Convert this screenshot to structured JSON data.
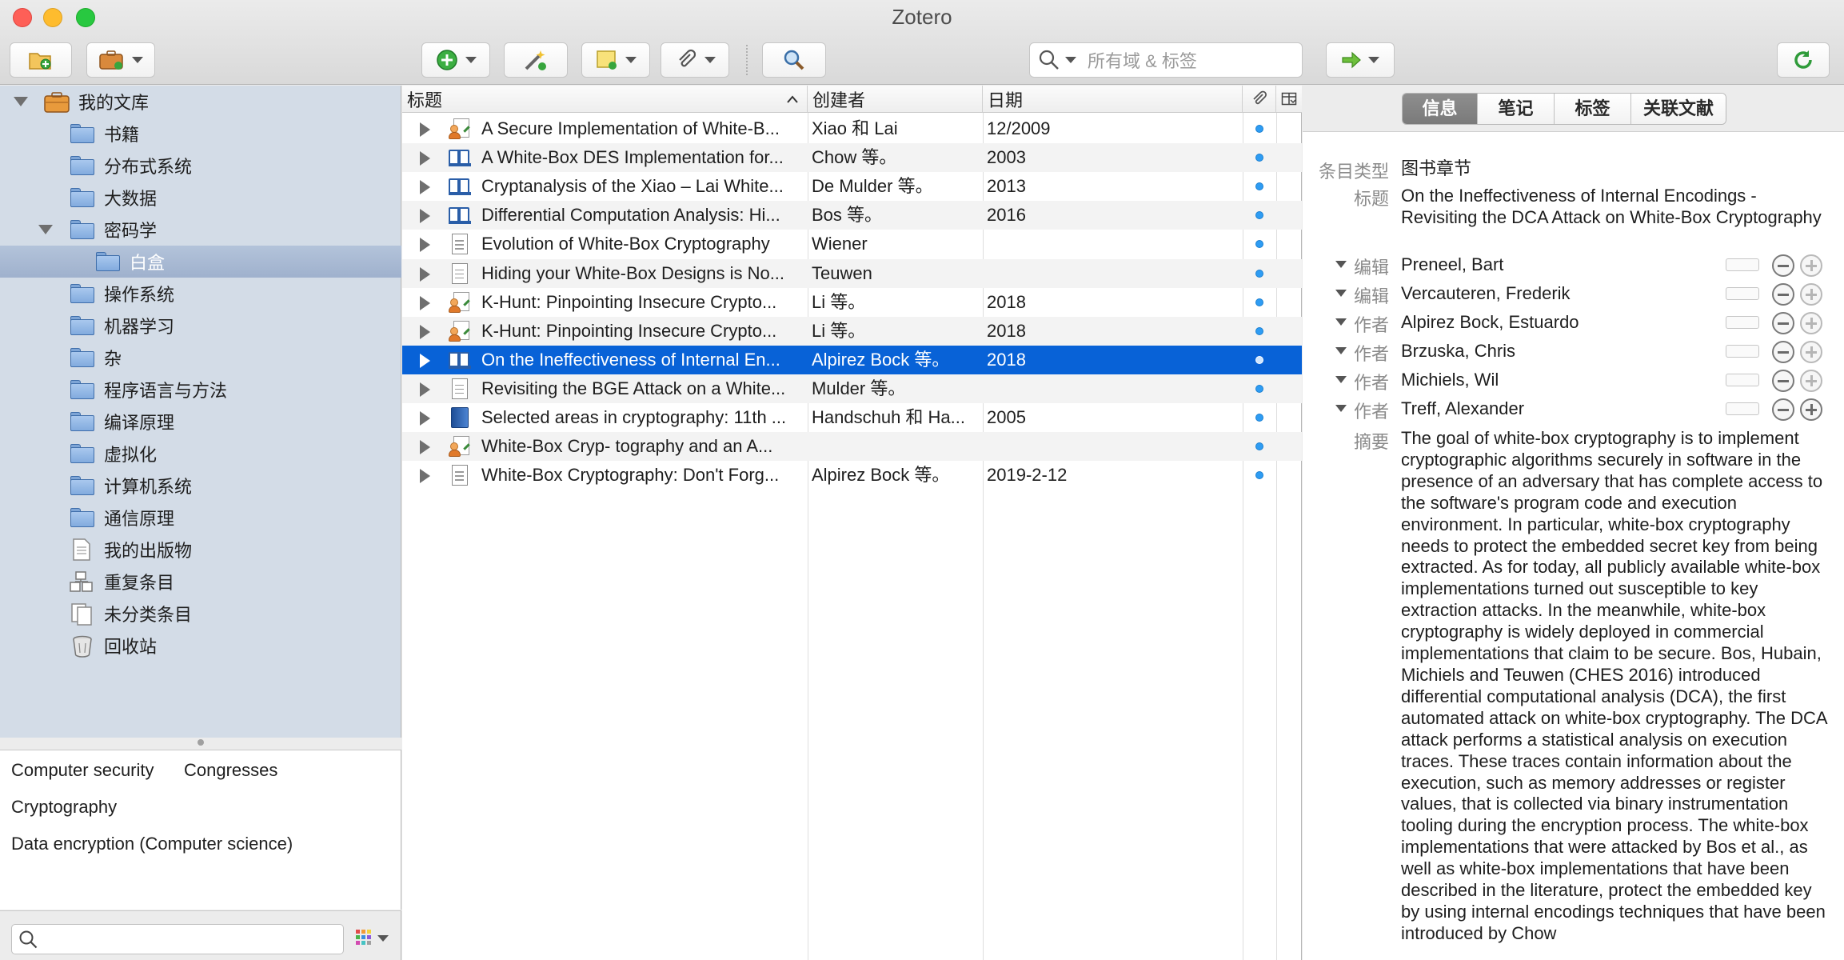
{
  "window": {
    "title": "Zotero"
  },
  "toolbar": {
    "search_placeholder": "所有域 & 标签",
    "colors": {
      "accent_green": "#2f9b3a",
      "folder_orange": "#e89a3c"
    }
  },
  "library": {
    "root": "我的文库",
    "collections": [
      {
        "label": "书籍"
      },
      {
        "label": "分布式系统"
      },
      {
        "label": "大数据"
      },
      {
        "label": "密码学"
      },
      {
        "label": "白盒"
      },
      {
        "label": "操作系统"
      },
      {
        "label": "机器学习"
      },
      {
        "label": "杂"
      },
      {
        "label": "程序语言与方法"
      },
      {
        "label": "编译原理"
      },
      {
        "label": "虚拟化"
      },
      {
        "label": "计算机系统"
      },
      {
        "label": "通信原理"
      }
    ],
    "special": [
      {
        "label": "我的出版物",
        "icon": "document-icon"
      },
      {
        "label": "重复条目",
        "icon": "duplicate-items-icon"
      },
      {
        "label": "未分类条目",
        "icon": "unfiled-items-icon"
      },
      {
        "label": "回收站",
        "icon": "trash-icon"
      }
    ]
  },
  "tags": [
    "Computer security",
    "Congresses",
    "Cryptography",
    "Data encryption (Computer science)"
  ],
  "items": {
    "columns": {
      "title": "标题",
      "creator": "创建者",
      "date": "日期"
    },
    "rows": [
      {
        "title": "A Secure Implementation of White-B...",
        "creator": "Xiao 和 Lai",
        "date": "12/2009",
        "icon": "conference-paper-icon"
      },
      {
        "title": "A White-Box DES Implementation for...",
        "creator": "Chow 等。",
        "date": "2003",
        "icon": "book-section-icon"
      },
      {
        "title": "Cryptanalysis of the Xiao – Lai White...",
        "creator": "De Mulder 等。",
        "date": "2013",
        "icon": "book-section-icon"
      },
      {
        "title": "Differential Computation Analysis: Hi...",
        "creator": "Bos 等。",
        "date": "2016",
        "icon": "book-section-icon"
      },
      {
        "title": "Evolution of White-Box Cryptography",
        "creator": "Wiener",
        "date": "",
        "icon": "document-icon"
      },
      {
        "title": "Hiding your White-Box Designs is No...",
        "creator": "Teuwen",
        "date": "",
        "icon": "document-icon"
      },
      {
        "title": "K-Hunt: Pinpointing Insecure Crypto...",
        "creator": "Li 等。",
        "date": "2018",
        "icon": "conference-paper-icon"
      },
      {
        "title": "K-Hunt: Pinpointing Insecure Crypto...",
        "creator": "Li 等。",
        "date": "2018",
        "icon": "conference-paper-icon"
      },
      {
        "title": "On the Ineffectiveness of Internal En...",
        "creator": "Alpirez Bock 等。",
        "date": "2018",
        "icon": "book-section-icon",
        "selected": true
      },
      {
        "title": "Revisiting the BGE Attack on a White...",
        "creator": "Mulder 等。",
        "date": "",
        "icon": "document-icon"
      },
      {
        "title": "Selected areas in cryptography: 11th ...",
        "creator": "Handschuh 和 Ha...",
        "date": "2005",
        "icon": "book-icon"
      },
      {
        "title": "White-Box Cryp- tography and an A...",
        "creator": "",
        "date": "",
        "icon": "conference-paper-icon"
      },
      {
        "title": "White-Box Cryptography: Don't Forg...",
        "creator": "Alpirez Bock 等。",
        "date": "2019-2-12",
        "icon": "document-icon"
      }
    ]
  },
  "detail": {
    "tabs": [
      "信息",
      "笔记",
      "标签",
      "关联文献"
    ],
    "item_type_label": "条目类型",
    "item_type": "图书章节",
    "title_label": "标题",
    "title": "On the Ineffectiveness of Internal Encodings - Revisiting the DCA Attack on White-Box Cryptography",
    "creators": [
      {
        "role": "编辑",
        "name": "Preneel, Bart"
      },
      {
        "role": "编辑",
        "name": "Vercauteren, Frederik"
      },
      {
        "role": "作者",
        "name": "Alpirez Bock, Estuardo"
      },
      {
        "role": "作者",
        "name": "Brzuska, Chris"
      },
      {
        "role": "作者",
        "name": "Michiels, Wil"
      },
      {
        "role": "作者",
        "name": "Treff, Alexander"
      }
    ],
    "abstract_label": "摘要",
    "abstract": "The goal of white-box cryptography is to implement cryptographic algorithms securely in software in the presence of an adversary that has complete access to the software's program code and execution environment. In particular, white-box cryptography needs to protect the embedded secret key from being extracted. As for today, all publicly available white-box implementations turned out susceptible to key extraction attacks. In the meanwhile, white-box cryptography is widely deployed in commercial implementations that claim to be secure. Bos, Hubain, Michiels and Teuwen (CHES 2016) introduced differential computational analysis (DCA), the first automated attack on white-box cryptography. The DCA attack performs a statistical analysis on execution traces. These traces contain information about the execution, such as memory addresses or register values, that is collected via binary instrumentation tooling during the encryption process. The white-box implementations that were attacked by Bos et al., as well as white-box implementations that have been described in the literature, protect the embedded key by using internal encodings techniques that have been introduced by Chow"
  }
}
